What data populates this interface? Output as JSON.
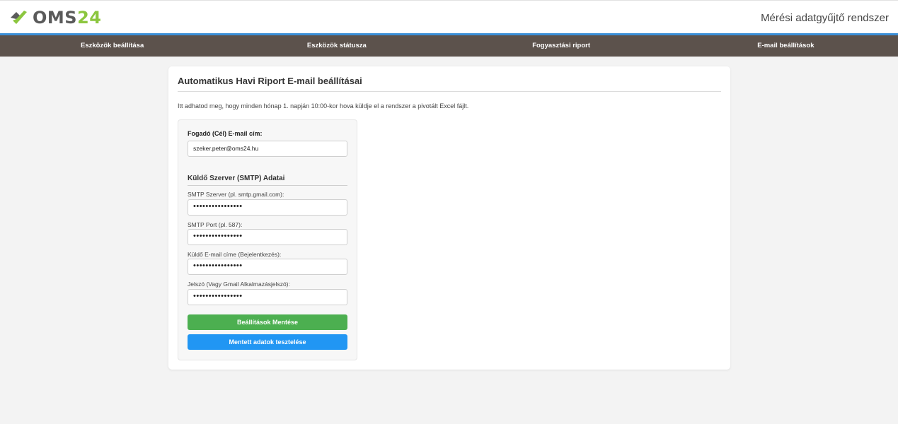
{
  "header": {
    "logo_oms": "OMS",
    "logo_num": "24",
    "app_title": "Mérési adatgyűjtő rendszer"
  },
  "nav": {
    "items": [
      {
        "label": "Eszközök beállítása"
      },
      {
        "label": "Eszközök státusza"
      },
      {
        "label": "Fogyasztási riport"
      },
      {
        "label": "E-mail beállítások"
      }
    ]
  },
  "card": {
    "title": "Automatikus Havi Riport E-mail beállításai",
    "description": "Itt adhatod meg, hogy minden hónap 1. napján 10:00-kor hova küldje el a rendszer a pivotált Excel fájlt."
  },
  "form": {
    "recipient_label": "Fogadó (Cél) E-mail cím:",
    "recipient_value": "szeker.peter@oms24.hu",
    "smtp_section_title": "Küldő Szerver (SMTP) Adatai",
    "smtp_server_label": "SMTP Szerver (pl. smtp.gmail.com):",
    "smtp_server_value": "••••••••••••••••",
    "smtp_port_label": "SMTP Port (pl. 587):",
    "smtp_port_value": "••••••••••••••••",
    "sender_email_label": "Küldő E-mail címe (Bejelentkezés):",
    "sender_email_value": "••••••••••••••••",
    "password_label": "Jelszó (Vagy Gmail Alkalmazásjelszó):",
    "password_value": "••••••••••••••••",
    "save_button": "Beállítások Mentése",
    "test_button": "Mentett adatok tesztelése"
  },
  "colors": {
    "accent_blue": "#3a8fd8",
    "nav_bg": "#5c524c",
    "logo_green": "#8cc63f",
    "save_green": "#4caf50",
    "test_blue": "#2196f3"
  }
}
